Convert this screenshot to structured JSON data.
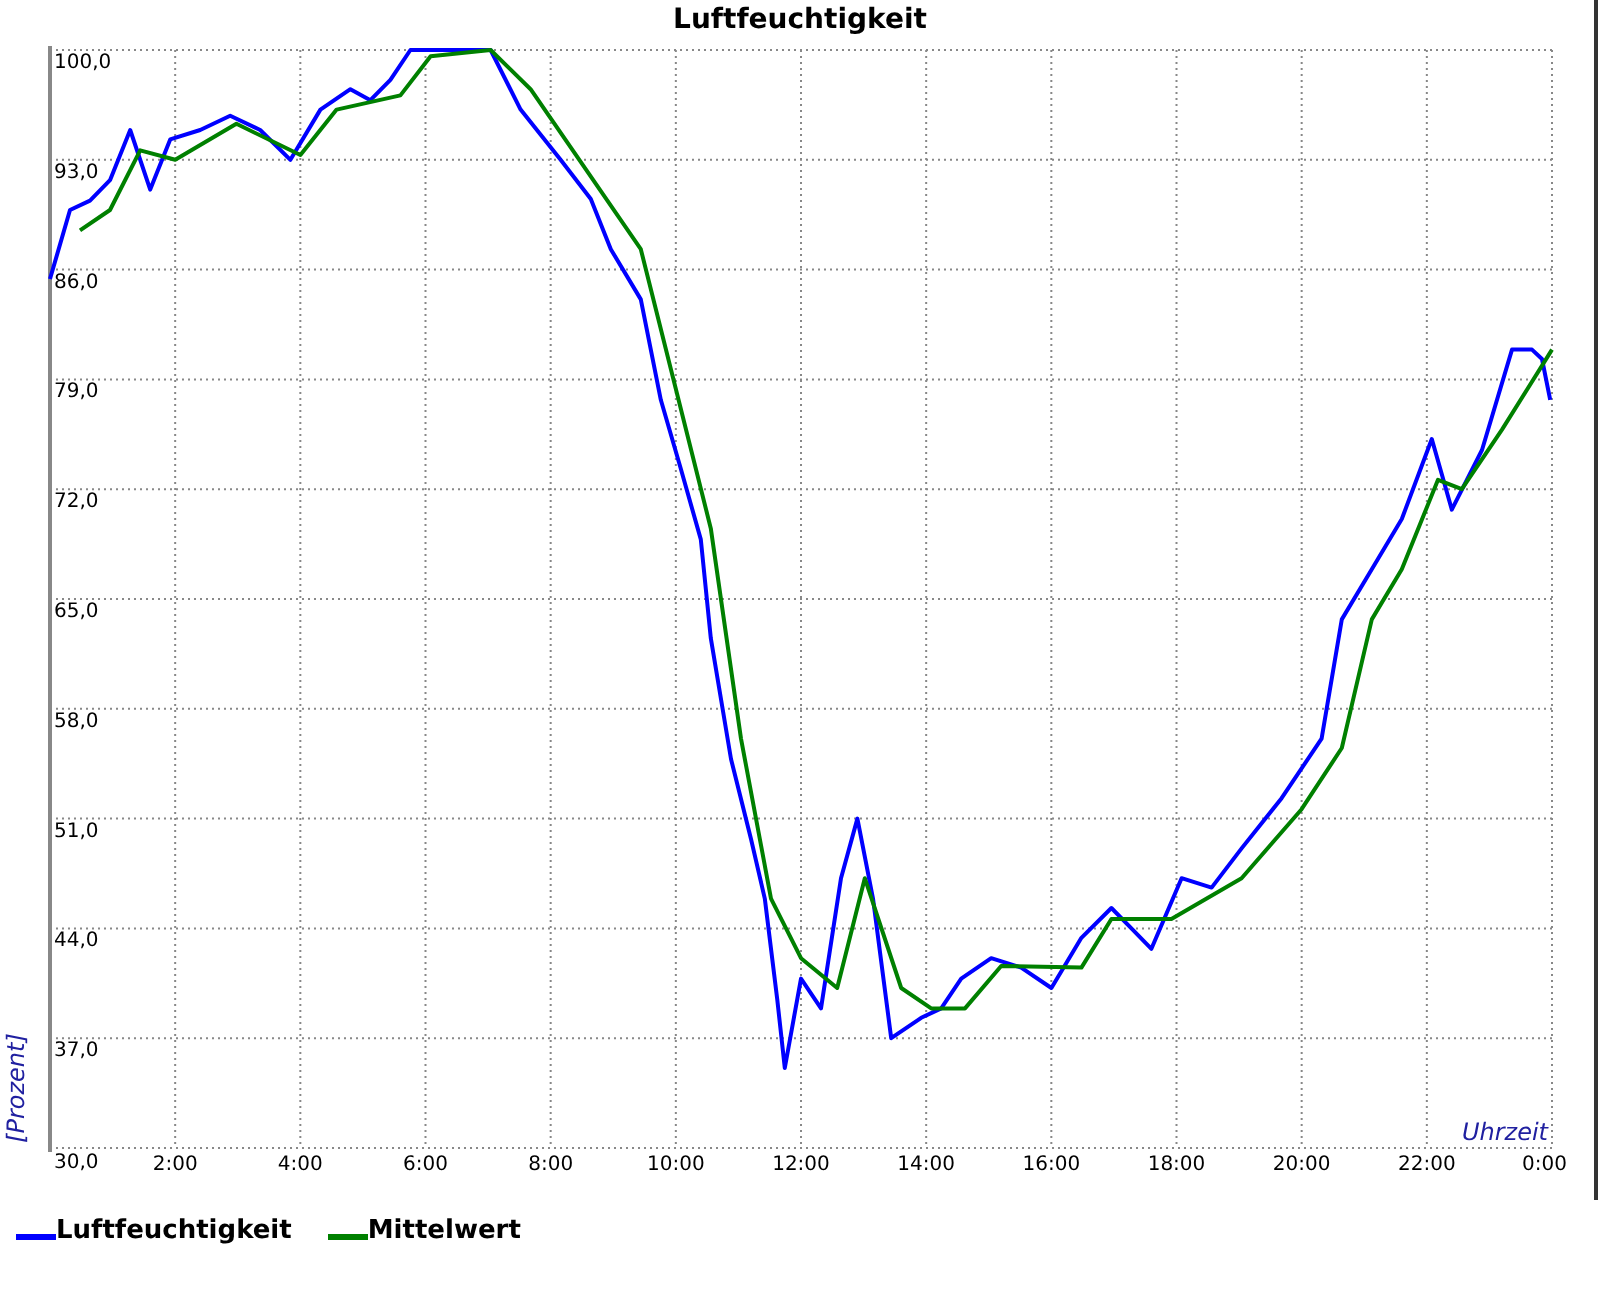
{
  "chart": {
    "chart_data": {
      "type": "line",
      "title": "Luftfeuchtigkeit",
      "xlabel": "Uhrzeit",
      "ylabel": "[Prozent]",
      "xlim": [
        0,
        24
      ],
      "ylim": [
        30,
        100
      ],
      "grid": true,
      "legend": "bottom",
      "xticks": [
        {
          "value": 2,
          "label": "2:00"
        },
        {
          "value": 4,
          "label": "4:00"
        },
        {
          "value": 6,
          "label": "6:00"
        },
        {
          "value": 8,
          "label": "8:00"
        },
        {
          "value": 10,
          "label": "10:00"
        },
        {
          "value": 12,
          "label": "12:00"
        },
        {
          "value": 14,
          "label": "14:00"
        },
        {
          "value": 16,
          "label": "16:00"
        },
        {
          "value": 18,
          "label": "18:00"
        },
        {
          "value": 20,
          "label": "20:00"
        },
        {
          "value": 22,
          "label": "22:00"
        },
        {
          "value": 24,
          "label": "0:00"
        }
      ],
      "yticks": [
        {
          "value": 30,
          "label": "30,0"
        },
        {
          "value": 37,
          "label": "37,0"
        },
        {
          "value": 44,
          "label": "44,0"
        },
        {
          "value": 51,
          "label": "51,0"
        },
        {
          "value": 58,
          "label": "58,0"
        },
        {
          "value": 65,
          "label": "65,0"
        },
        {
          "value": 72,
          "label": "72,0"
        },
        {
          "value": 79,
          "label": "79,0"
        },
        {
          "value": 86,
          "label": "86,0"
        },
        {
          "value": 93,
          "label": "93,0"
        },
        {
          "value": 100,
          "label": "100,0"
        }
      ],
      "series": [
        {
          "name": "Luftfeuchtigkeit",
          "color": "#0000ff",
          "x": [
            0,
            0.32,
            0.64,
            0.96,
            1.28,
            1.6,
            1.92,
            2.4,
            2.88,
            3.36,
            3.84,
            4.32,
            4.8,
            5.12,
            5.44,
            5.76,
            7.04,
            7.52,
            8.16,
            8.64,
            8.96,
            9.44,
            9.76,
            10.08,
            10.4,
            10.56,
            10.88,
            11.2,
            11.42,
            11.62,
            11.74,
            12.0,
            12.32,
            12.64,
            12.9,
            13.15,
            13.44,
            13.92,
            14.24,
            14.56,
            15.04,
            15.52,
            16.0,
            16.48,
            16.96,
            17.28,
            17.6,
            18.08,
            18.56,
            19.04,
            19.68,
            20.32,
            20.64,
            21.12,
            21.6,
            22.08,
            22.4,
            22.88,
            23.36,
            23.68,
            23.84,
            23.97
          ],
          "values": [
            85.4,
            89.8,
            90.4,
            91.7,
            94.9,
            91.1,
            94.3,
            94.9,
            95.8,
            94.9,
            93.0,
            96.2,
            97.5,
            96.8,
            98.1,
            100,
            100,
            96.2,
            93.0,
            90.5,
            87.3,
            84.1,
            77.7,
            73.3,
            68.8,
            62.5,
            54.8,
            49.7,
            45.9,
            39.5,
            35.1,
            40.8,
            38.9,
            47.2,
            51.0,
            45.9,
            37.0,
            38.3,
            38.9,
            40.8,
            42.1,
            41.5,
            40.2,
            43.4,
            45.3,
            44.0,
            42.7,
            47.2,
            46.6,
            49.1,
            52.3,
            56.1,
            63.7,
            66.9,
            70.1,
            75.2,
            70.7,
            74.5,
            80.9,
            80.9,
            80.3,
            77.7
          ]
        },
        {
          "name": "Mittelwert",
          "color": "#008000",
          "x": [
            0.48,
            0.96,
            1.44,
            2.0,
            2.98,
            4.0,
            4.58,
            5.6,
            6.08,
            7.04,
            7.68,
            9.44,
            10.56,
            11.04,
            11.52,
            12.0,
            12.58,
            13.02,
            13.6,
            14.08,
            14.62,
            15.2,
            16.48,
            16.96,
            17.92,
            19.04,
            20.0,
            20.64,
            21.12,
            21.6,
            22.18,
            22.56,
            23.2,
            24.0
          ],
          "values": [
            88.5,
            89.8,
            93.6,
            93.0,
            95.3,
            93.3,
            96.2,
            97.1,
            99.6,
            100,
            97.5,
            87.3,
            69.5,
            56.1,
            45.9,
            42.1,
            40.2,
            47.2,
            40.2,
            38.9,
            38.9,
            41.6,
            41.5,
            44.6,
            44.6,
            47.2,
            51.6,
            55.5,
            63.7,
            66.9,
            72.6,
            72.0,
            75.8,
            80.9
          ]
        }
      ]
    }
  }
}
